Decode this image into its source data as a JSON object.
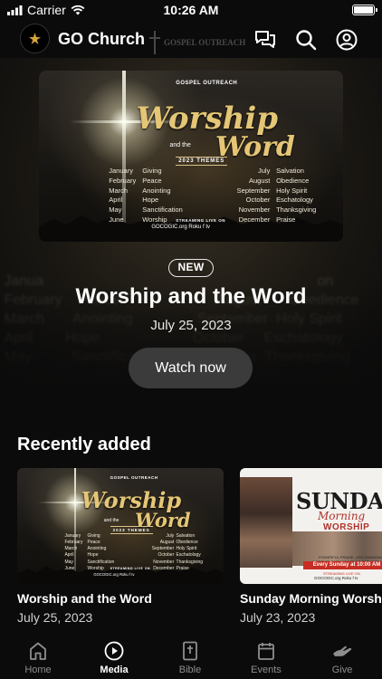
{
  "status_bar": {
    "carrier": "Carrier",
    "time": "10:26 AM"
  },
  "header": {
    "app_title": "GO Church",
    "watermark_text": "GOSPEL OUTREACH"
  },
  "featured": {
    "badge": "NEW",
    "title": "Worship and the Word",
    "date": "July 25, 2023",
    "watch_label": "Watch now"
  },
  "poster": {
    "brand": "GOSPEL OUTREACH",
    "title_line1": "Worship",
    "and_the": "and the",
    "title_line2": "Word",
    "themes_label": "2023 THEMES",
    "months_left": [
      "January",
      "February",
      "March",
      "April",
      "May",
      "June"
    ],
    "themes_left": [
      "Giving",
      "Peace",
      "Anointing",
      "Hope",
      "Sanctification",
      "Worship"
    ],
    "months_right": [
      "July",
      "August",
      "September",
      "October",
      "November",
      "December"
    ],
    "themes_right": [
      "Salvation",
      "Obedience",
      "Holy Spirit",
      "Eschatology",
      "Thanksgiving",
      "Praise"
    ],
    "streaming_label": "STREAMING LIVE ON",
    "platforms": "GOCOGIC.org   Roku   f   tv"
  },
  "recently_added": {
    "section_title": "Recently added",
    "items": [
      {
        "title": "Worship and the Word",
        "date": "July 25, 2023"
      },
      {
        "title": "Sunday Morning Worship",
        "date": "July 23, 2023"
      }
    ]
  },
  "sunday_poster": {
    "word_top": "SUNDAY",
    "word_mid": "Morning",
    "word_bottom": "WORSHIP",
    "small_text": "POWERFUL PRAISE, LIFE CHANGING WORSHIP, FAITH-FILLED PRAYER AND MOST OF ALL SPIRIT-LED PREACHING",
    "banner": "Every Sunday at 10:00 AM",
    "streaming": "STREAMING LIVE ON",
    "platforms": "GOCOGIC.org   Roku   f   tv"
  },
  "tab_bar": {
    "tabs": [
      {
        "label": "Home",
        "icon": "home-icon",
        "active": false
      },
      {
        "label": "Media",
        "icon": "play-circle-icon",
        "active": true
      },
      {
        "label": "Bible",
        "icon": "bible-icon",
        "active": false
      },
      {
        "label": "Events",
        "icon": "calendar-icon",
        "active": false
      },
      {
        "label": "Give",
        "icon": "give-hand-icon",
        "active": false
      }
    ]
  },
  "colors": {
    "background": "#0b0b0b",
    "accent_gold": "#e4c676",
    "button_bg": "#3b3b3b",
    "tab_inactive": "#8e8e8e"
  }
}
